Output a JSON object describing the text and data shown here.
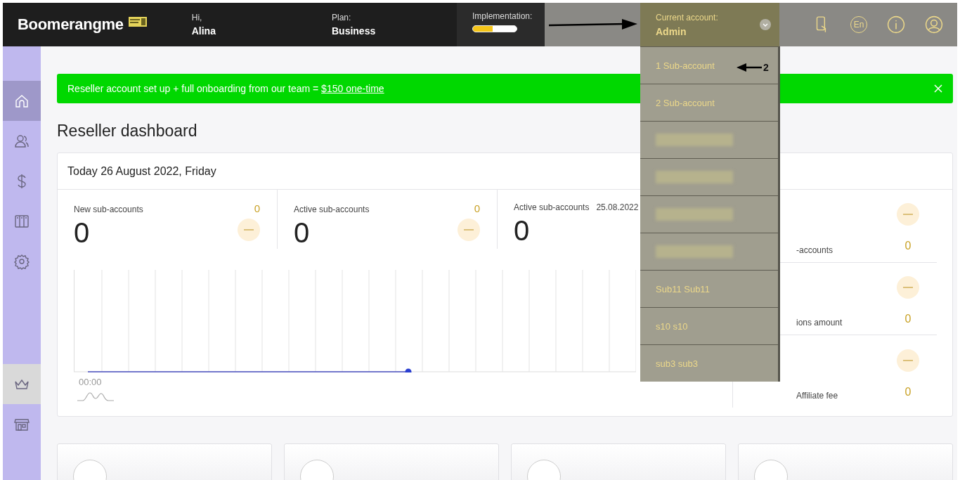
{
  "header": {
    "logo": "Boomerangme",
    "greeting": {
      "label": "Hi,",
      "value": "Alina"
    },
    "plan": {
      "label": "Plan:",
      "value": "Business"
    },
    "implementation": {
      "label": "Implementation:",
      "level": 0.45
    },
    "language": "En"
  },
  "account_menu": {
    "label": "Current account:",
    "value": "Admin",
    "expanded": true,
    "items": [
      {
        "kind": "text",
        "label": "1 Sub-account"
      },
      {
        "kind": "text",
        "label": "2 Sub-account"
      },
      {
        "kind": "blurred"
      },
      {
        "kind": "blurred"
      },
      {
        "kind": "blurred"
      },
      {
        "kind": "blurred"
      },
      {
        "kind": "text",
        "label": "Sub11 Sub11"
      },
      {
        "kind": "text",
        "label": "s10 s10"
      },
      {
        "kind": "text",
        "label": "sub3 sub3"
      }
    ],
    "annotation": "2"
  },
  "sidebar": {
    "items": [
      {
        "selected": true,
        "hovered": false
      },
      {
        "selected": false,
        "hovered": false
      },
      {
        "selected": false,
        "hovered": false
      },
      {
        "selected": false,
        "hovered": false
      },
      {
        "selected": false,
        "hovered": false
      },
      {
        "selected": false,
        "hovered": true
      },
      {
        "selected": false,
        "hovered": false
      }
    ]
  },
  "banner": {
    "text": "Reseller account set up + full onboarding from our team = ",
    "link": "$150 one-time"
  },
  "title": "Reseller dashboard",
  "card": {
    "date": "Today 26 August 2022, Friday",
    "stats": [
      {
        "label": "New sub-accounts",
        "change": "0",
        "value": "0"
      },
      {
        "label": "Active sub-accounts",
        "change": "0",
        "value": "0"
      },
      {
        "label": "Active sub-accounts",
        "date": "25.08.2022",
        "value": "0"
      }
    ],
    "chart_start": "00:00",
    "side": [
      {
        "label": "-accounts",
        "value": "0"
      },
      {
        "label": "ions amount",
        "value": "0"
      },
      {
        "label": "Affiliate fee",
        "value": "0"
      }
    ]
  },
  "bottom_cards": [
    {
      "kind": "card"
    },
    {
      "kind": "card"
    },
    {
      "kind": "card"
    },
    {
      "kind": "card"
    }
  ]
}
